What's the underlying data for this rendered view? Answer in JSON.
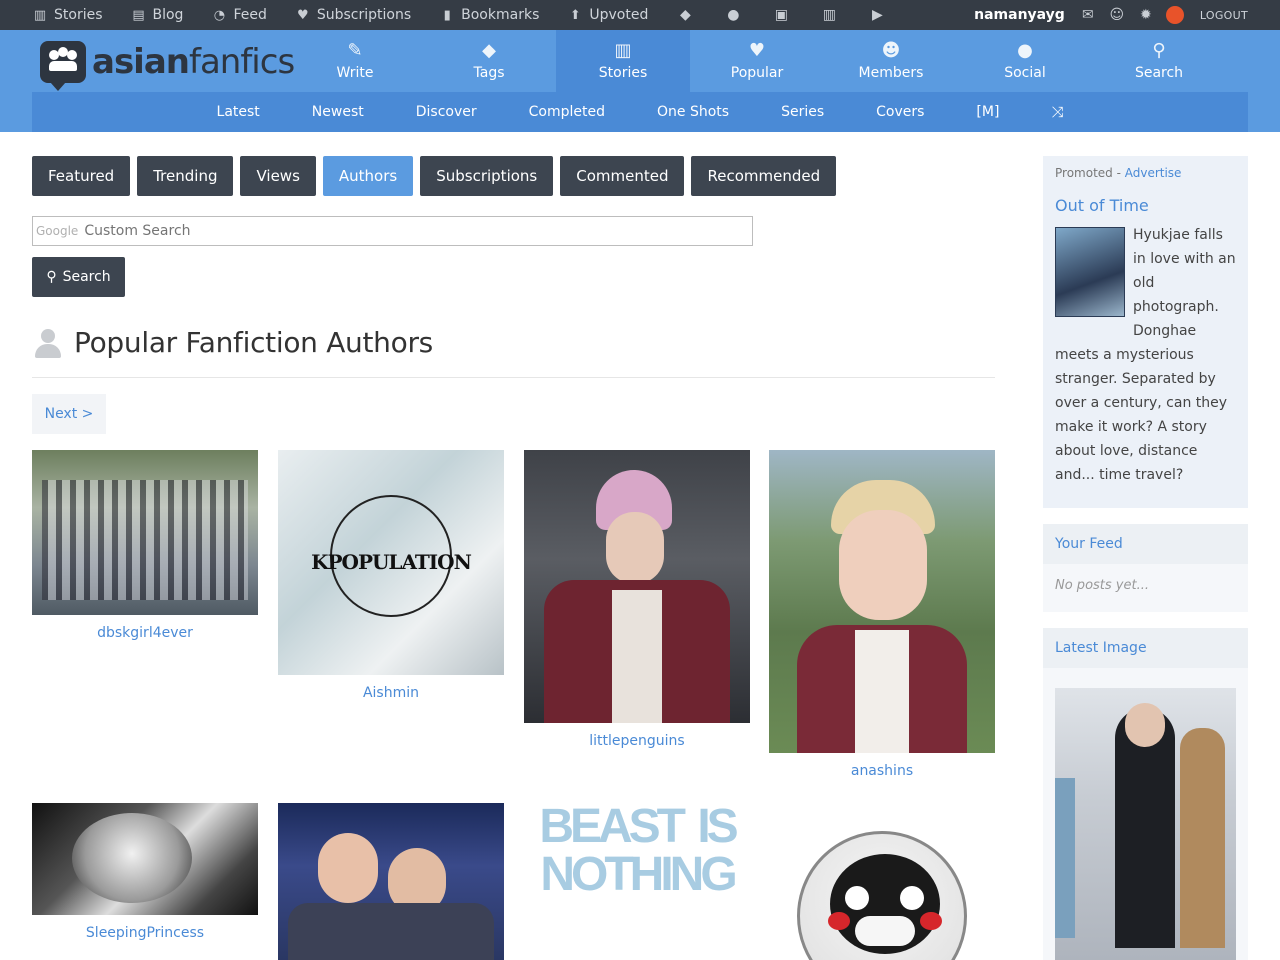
{
  "topbar": {
    "items": [
      {
        "label": "Stories",
        "icon": "books-icon"
      },
      {
        "label": "Blog",
        "icon": "blog-icon"
      },
      {
        "label": "Feed",
        "icon": "rss-icon"
      },
      {
        "label": "Subscriptions",
        "icon": "heart-icon"
      },
      {
        "label": "Bookmarks",
        "icon": "bookmark-icon"
      },
      {
        "label": "Upvoted",
        "icon": "arrow-up-icon"
      }
    ],
    "username": "namanyayg",
    "logout": "LOGOUT"
  },
  "logo": {
    "bold": "asian",
    "light": "fanfics"
  },
  "mainnav": [
    {
      "label": "Write",
      "icon": "quill-icon"
    },
    {
      "label": "Tags",
      "icon": "tag-icon"
    },
    {
      "label": "Stories",
      "icon": "books-icon"
    },
    {
      "label": "Popular",
      "icon": "heart-icon"
    },
    {
      "label": "Members",
      "icon": "user-icon"
    },
    {
      "label": "Social",
      "icon": "chat-icon"
    },
    {
      "label": "Search",
      "icon": "search-icon"
    }
  ],
  "subnav": [
    "Latest",
    "Newest",
    "Discover",
    "Completed",
    "One Shots",
    "Series",
    "Covers",
    "[M]"
  ],
  "tabs": [
    "Featured",
    "Trending",
    "Views",
    "Authors",
    "Subscriptions",
    "Commented",
    "Recommended"
  ],
  "search": {
    "brand": "Google",
    "placeholder": "Custom Search",
    "button": "Search"
  },
  "page": {
    "title": "Popular Fanfiction Authors",
    "next": "Next >"
  },
  "authors": [
    {
      "name": "dbskgirl4ever"
    },
    {
      "name": "Aishmin",
      "overlay": "KPOPULATION"
    },
    {
      "name": "littlepenguins"
    },
    {
      "name": "anashins"
    },
    {
      "name": "SleepingPrincess"
    },
    {
      "name": ""
    },
    {
      "name": "",
      "overlay": "BEAST IS NOTHING"
    },
    {
      "name": ""
    }
  ],
  "promo": {
    "label": "Promoted - ",
    "advertise": "Advertise",
    "title": "Out of Time",
    "description": "Hyukjae falls in love with an old photograph. Donghae meets a mysterious stranger. Separated by over a century, can they make it work? A story about love, distance and... time travel?"
  },
  "feed": {
    "title": "Your Feed",
    "empty": "No posts yet..."
  },
  "latest_image": {
    "title": "Latest Image"
  }
}
